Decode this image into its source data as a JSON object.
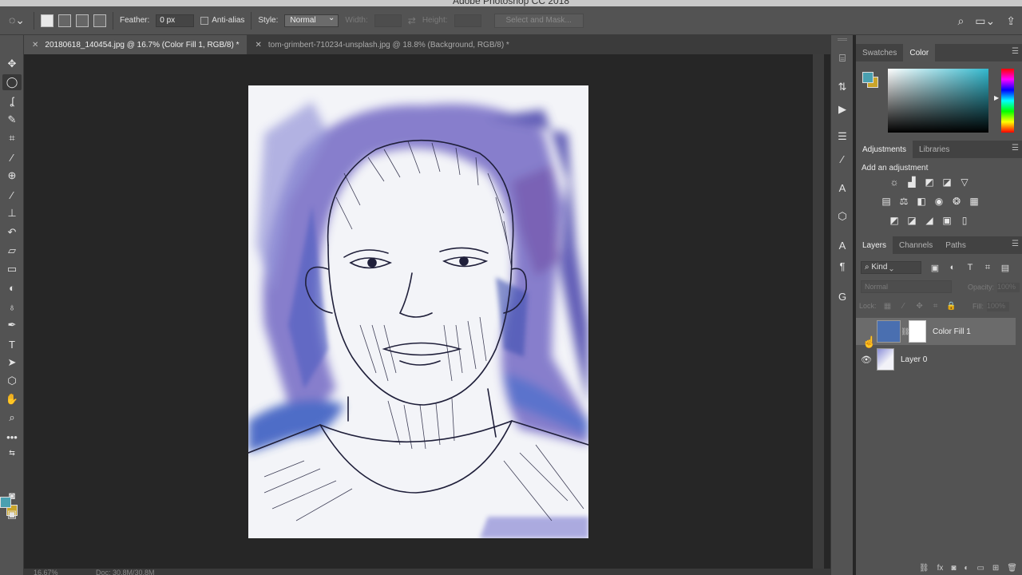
{
  "app_title": "Adobe Photoshop CC 2018",
  "options_bar": {
    "feather_label": "Feather:",
    "feather_value": "0 px",
    "antialias_label": "Anti-alias",
    "style_label": "Style:",
    "style_value": "Normal",
    "width_label": "Width:",
    "height_label": "Height:",
    "select_mask_label": "Select and Mask..."
  },
  "tabs": [
    {
      "label": "20180618_140454.jpg @ 16.7% (Color Fill 1, RGB/8) *",
      "active": true
    },
    {
      "label": "tom-grimbert-710234-unsplash.jpg @ 18.8% (Background, RGB/8) *",
      "active": false
    }
  ],
  "status": {
    "zoom": "16.67%",
    "doc": "Doc: 30.8M/30.8M"
  },
  "color_panel": {
    "tabs": [
      "Swatches",
      "Color"
    ],
    "active": "Color",
    "foreground": "#4aa0b0",
    "background": "#c9a42a"
  },
  "adjustments_panel": {
    "tabs": [
      "Adjustments",
      "Libraries"
    ],
    "title": "Add an adjustment"
  },
  "layers_panel": {
    "tabs": [
      "Layers",
      "Channels",
      "Paths"
    ],
    "filter_kind": "Kind",
    "blend_mode": "Normal",
    "opacity_label": "Opacity:",
    "opacity_value": "100%",
    "lock_label": "Lock:",
    "fill_label": "Fill:",
    "fill_value": "100%",
    "layers": [
      {
        "name": "Color Fill 1",
        "selected": true,
        "visible": false,
        "fill_color": "#4a6fb0"
      },
      {
        "name": "Layer 0",
        "selected": false,
        "visible": true
      }
    ]
  },
  "icons": {
    "tools": [
      "move-icon",
      "marquee-icon",
      "lasso-icon",
      "quick-select-icon",
      "crop-icon",
      "eyedropper-icon",
      "healing-icon",
      "brush-icon",
      "stamp-icon",
      "history-brush-icon",
      "eraser-icon",
      "gradient-icon",
      "blur-icon",
      "dodge-icon",
      "pen-icon",
      "type-icon",
      "path-select-icon",
      "shape-icon",
      "hand-icon",
      "zoom-icon",
      "more-icon"
    ]
  }
}
